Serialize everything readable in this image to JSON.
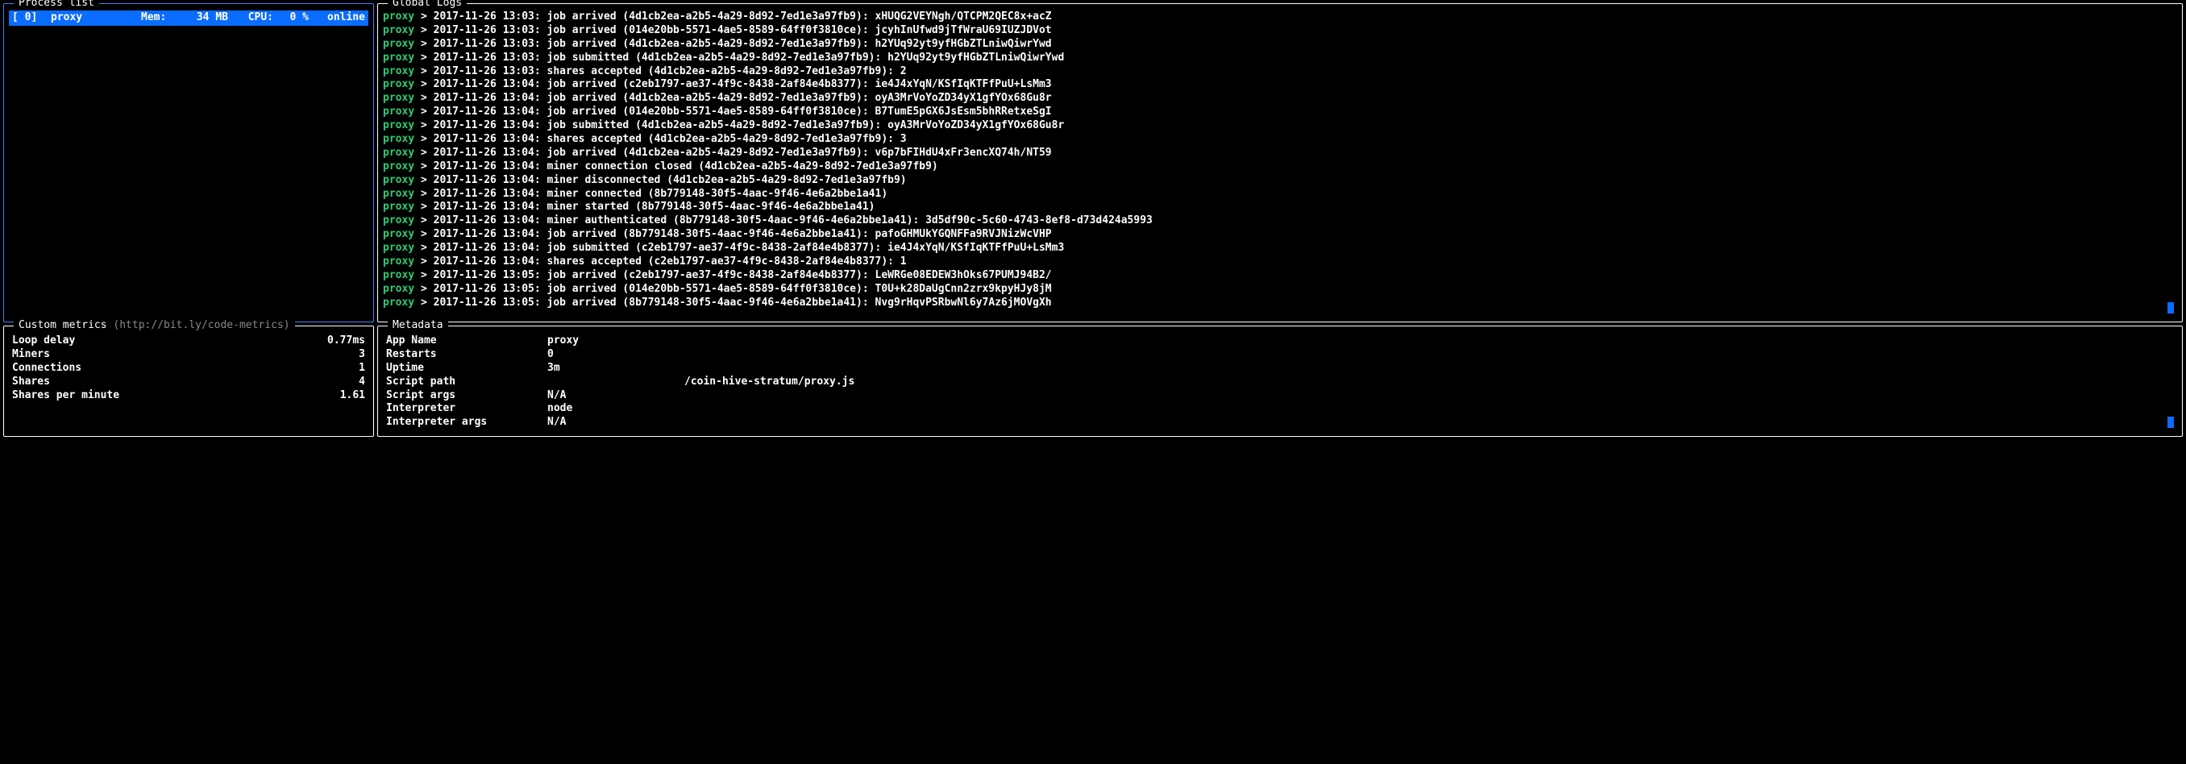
{
  "processList": {
    "title": "Process list",
    "rows": [
      {
        "id": "[ 0]",
        "name": "proxy",
        "memLabel": "Mem:",
        "mem": "34 MB",
        "cpuLabel": "CPU:",
        "cpu": "0 %",
        "status": "online"
      }
    ]
  },
  "globalLogs": {
    "title": "Global Logs",
    "lines": [
      {
        "prefix": "proxy",
        "text": " > 2017-11-26 13:03: job arrived (4d1cb2ea-a2b5-4a29-8d92-7ed1e3a97fb9): xHUQG2VEYNgh/QTCPM2QEC8x+acZ"
      },
      {
        "prefix": "proxy",
        "text": " > 2017-11-26 13:03: job arrived (014e20bb-5571-4ae5-8589-64ff0f3810ce): jcyhInUfwd9jTfWraU69IUZJDVot"
      },
      {
        "prefix": "proxy",
        "text": " > 2017-11-26 13:03: job arrived (4d1cb2ea-a2b5-4a29-8d92-7ed1e3a97fb9): h2YUq92yt9yfHGbZTLniwQiwrYwd"
      },
      {
        "prefix": "proxy",
        "text": " > 2017-11-26 13:03: job submitted (4d1cb2ea-a2b5-4a29-8d92-7ed1e3a97fb9): h2YUq92yt9yfHGbZTLniwQiwrYwd"
      },
      {
        "prefix": "proxy",
        "text": " > 2017-11-26 13:03: shares accepted (4d1cb2ea-a2b5-4a29-8d92-7ed1e3a97fb9): 2"
      },
      {
        "prefix": "proxy",
        "text": " > 2017-11-26 13:04: job arrived (c2eb1797-ae37-4f9c-8438-2af84e4b8377): ie4J4xYqN/KSfIqKTFfPuU+LsMm3"
      },
      {
        "prefix": "proxy",
        "text": " > 2017-11-26 13:04: job arrived (4d1cb2ea-a2b5-4a29-8d92-7ed1e3a97fb9): oyA3MrVoYoZD34yX1gfYOx68Gu8r"
      },
      {
        "prefix": "proxy",
        "text": " > 2017-11-26 13:04: job arrived (014e20bb-5571-4ae5-8589-64ff0f3810ce): B7TumE5pGX6JsEsm5bhRRetxeSgI"
      },
      {
        "prefix": "proxy",
        "text": " > 2017-11-26 13:04: job submitted (4d1cb2ea-a2b5-4a29-8d92-7ed1e3a97fb9): oyA3MrVoYoZD34yX1gfYOx68Gu8r"
      },
      {
        "prefix": "proxy",
        "text": " > 2017-11-26 13:04: shares accepted (4d1cb2ea-a2b5-4a29-8d92-7ed1e3a97fb9): 3"
      },
      {
        "prefix": "proxy",
        "text": " > 2017-11-26 13:04: job arrived (4d1cb2ea-a2b5-4a29-8d92-7ed1e3a97fb9): v6p7bFIHdU4xFr3encXQ74h/NT59"
      },
      {
        "prefix": "proxy",
        "text": " > 2017-11-26 13:04: miner connection closed (4d1cb2ea-a2b5-4a29-8d92-7ed1e3a97fb9)"
      },
      {
        "prefix": "proxy",
        "text": " > 2017-11-26 13:04: miner disconnected (4d1cb2ea-a2b5-4a29-8d92-7ed1e3a97fb9)"
      },
      {
        "prefix": "proxy",
        "text": " > 2017-11-26 13:04: miner connected (8b779148-30f5-4aac-9f46-4e6a2bbe1a41)"
      },
      {
        "prefix": "proxy",
        "text": " > 2017-11-26 13:04: miner started (8b779148-30f5-4aac-9f46-4e6a2bbe1a41)"
      },
      {
        "prefix": "proxy",
        "text": " > 2017-11-26 13:04: miner authenticated (8b779148-30f5-4aac-9f46-4e6a2bbe1a41): 3d5df90c-5c60-4743-8ef8-d73d424a5993"
      },
      {
        "prefix": "proxy",
        "text": " > 2017-11-26 13:04: job arrived (8b779148-30f5-4aac-9f46-4e6a2bbe1a41): pafoGHMUkYGQNFFa9RVJNizWcVHP"
      },
      {
        "prefix": "proxy",
        "text": " > 2017-11-26 13:04: job submitted (c2eb1797-ae37-4f9c-8438-2af84e4b8377): ie4J4xYqN/KSfIqKTFfPuU+LsMm3"
      },
      {
        "prefix": "proxy",
        "text": " > 2017-11-26 13:04: shares accepted (c2eb1797-ae37-4f9c-8438-2af84e4b8377): 1"
      },
      {
        "prefix": "proxy",
        "text": " > 2017-11-26 13:05: job arrived (c2eb1797-ae37-4f9c-8438-2af84e4b8377): LeWRGe08EDEW3hOks67PUMJ94B2/"
      },
      {
        "prefix": "proxy",
        "text": " > 2017-11-26 13:05: job arrived (014e20bb-5571-4ae5-8589-64ff0f3810ce): T0U+k28DaUgCnn2zrx9kpyHJy8jM"
      },
      {
        "prefix": "proxy",
        "text": " > 2017-11-26 13:05: job arrived (8b779148-30f5-4aac-9f46-4e6a2bbe1a41): Nvg9rHqvPSRbwNl6y7Az6jMOVgXh"
      }
    ]
  },
  "customMetrics": {
    "title": "Custom metrics",
    "subtitle": "(http://bit.ly/code-metrics)",
    "rows": [
      {
        "key": "Loop delay",
        "val": "0.77ms"
      },
      {
        "key": "Miners",
        "val": "3"
      },
      {
        "key": "Connections",
        "val": "1"
      },
      {
        "key": "Shares",
        "val": "4"
      },
      {
        "key": "Shares per minute",
        "val": "1.61"
      }
    ]
  },
  "metadata": {
    "title": "Metadata",
    "rows": [
      {
        "key": "App Name",
        "val": "proxy"
      },
      {
        "key": "Restarts",
        "val": "0"
      },
      {
        "key": "Uptime",
        "val": "3m"
      },
      {
        "key": "Script path",
        "val": "/coin-hive-stratum/proxy.js",
        "redactedPrefix": true
      },
      {
        "key": "Script args",
        "val": "N/A"
      },
      {
        "key": "Interpreter",
        "val": "node"
      },
      {
        "key": "Interpreter args",
        "val": "N/A"
      }
    ]
  }
}
